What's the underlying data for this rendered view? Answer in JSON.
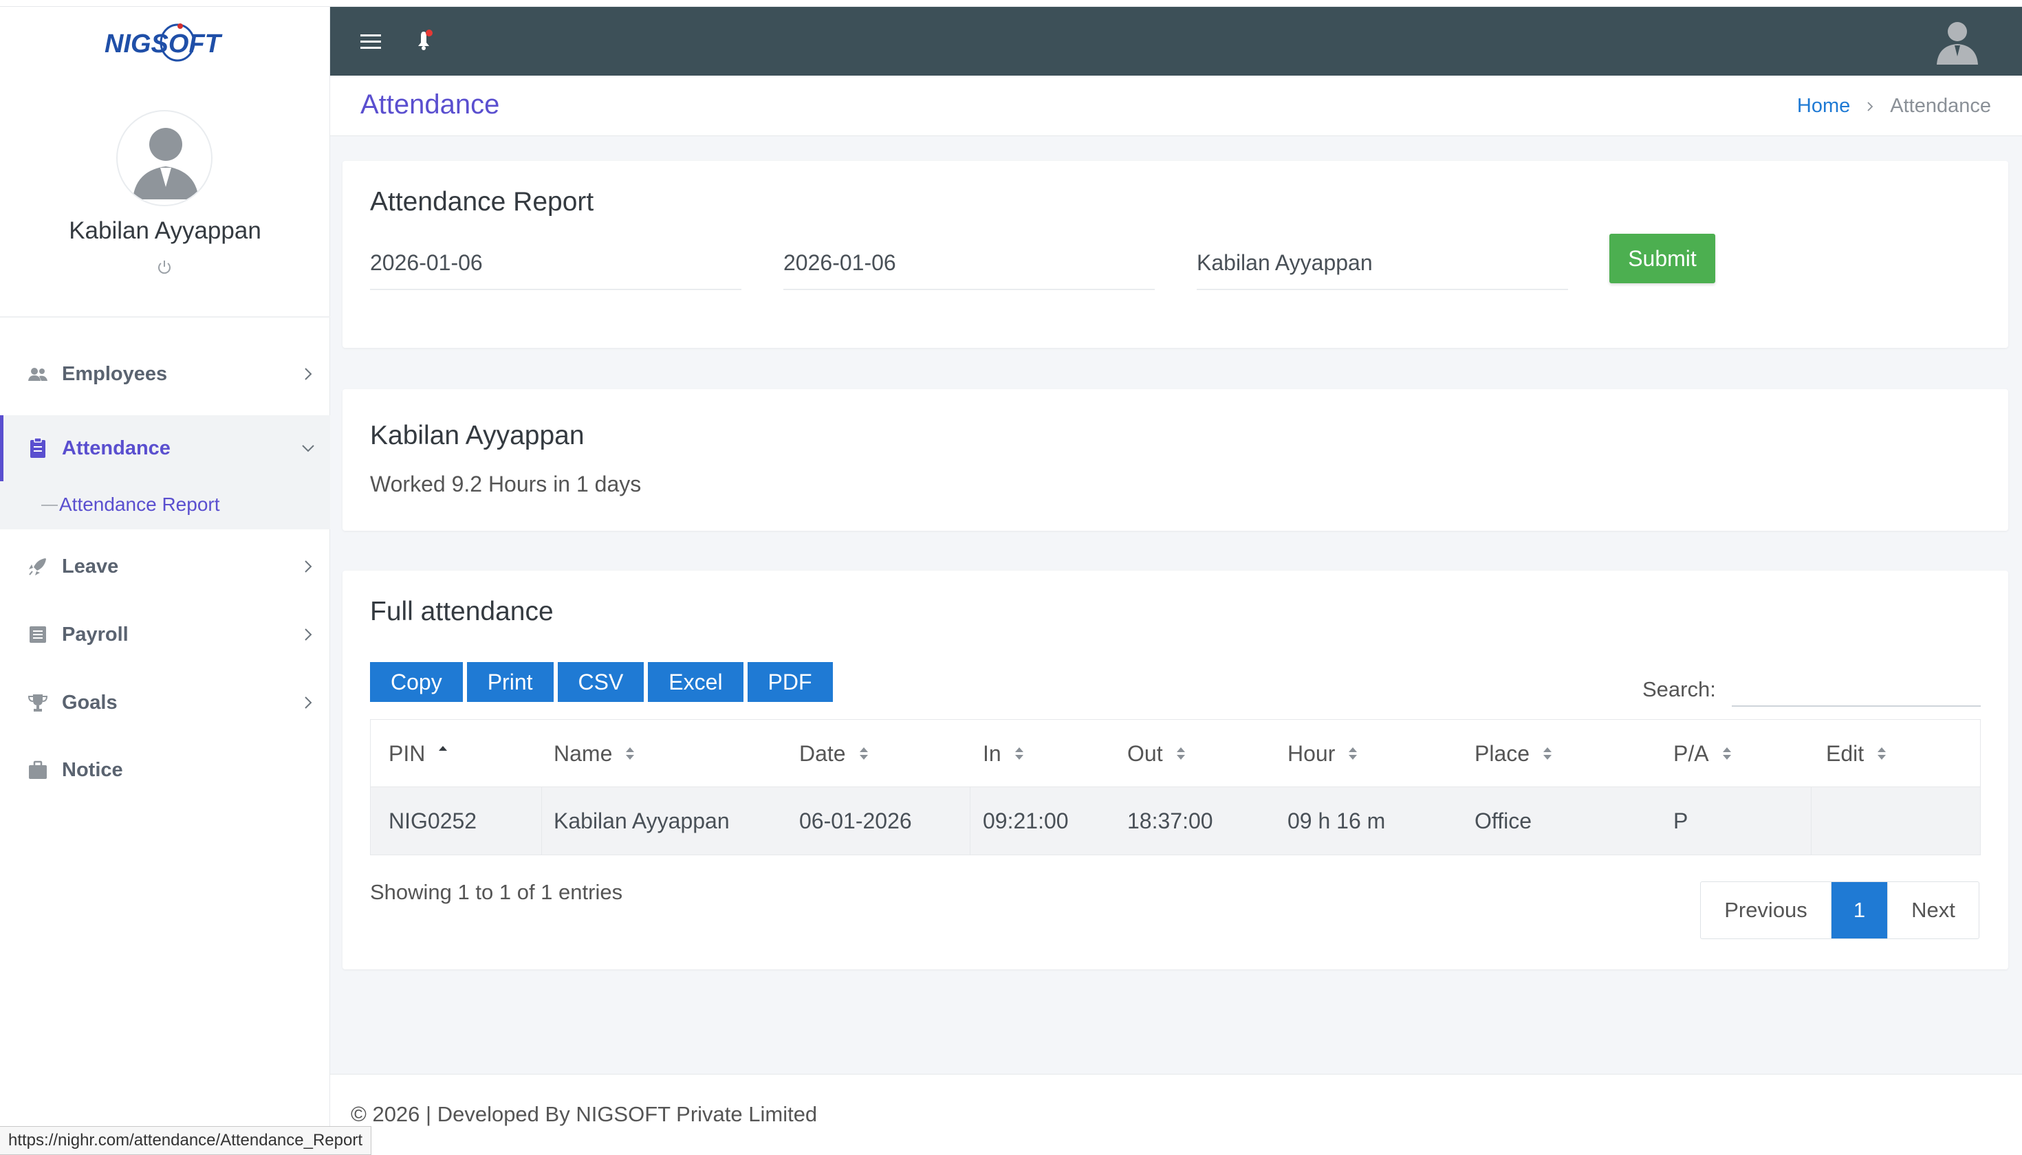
{
  "brand": {
    "logo_text": "NIGSOFT",
    "accent": "#5a4fcf",
    "primary": "#1f7ad4",
    "success": "#4caf50",
    "topbar": "#3d5058"
  },
  "sidebar": {
    "user_name": "Kabilan Ayyappan",
    "items": [
      {
        "label": "Employees",
        "icon": "users-icon"
      },
      {
        "label": "Attendance",
        "icon": "clipboard-icon",
        "active": true,
        "submenu": [
          "Attendance Report"
        ]
      },
      {
        "label": "Leave",
        "icon": "rocket-icon"
      },
      {
        "label": "Payroll",
        "icon": "list-icon"
      },
      {
        "label": "Goals",
        "icon": "trophy-icon"
      },
      {
        "label": "Notice",
        "icon": "briefcase-icon"
      }
    ]
  },
  "header": {
    "page_title": "Attendance",
    "breadcrumb": {
      "home": "Home",
      "current": "Attendance"
    }
  },
  "report_form": {
    "title": "Attendance Report",
    "from_date": "2026-01-06",
    "to_date": "2026-01-06",
    "employee": "Kabilan Ayyappan",
    "submit_label": "Submit"
  },
  "summary": {
    "name": "Kabilan Ayyappan",
    "worked_text": "Worked 9.2 Hours in 1 days"
  },
  "attendance": {
    "title": "Full attendance",
    "export_buttons": [
      "Copy",
      "Print",
      "CSV",
      "Excel",
      "PDF"
    ],
    "search_label": "Search:",
    "search_value": "",
    "columns": [
      "PIN",
      "Name",
      "Date",
      "In",
      "Out",
      "Hour",
      "Place",
      "P/A",
      "Edit"
    ],
    "rows": [
      [
        "NIG0252",
        "Kabilan Ayyappan",
        "06-01-2026",
        "09:21:00",
        "18:37:00",
        "09 h 16 m",
        "Office",
        "P",
        ""
      ]
    ],
    "showing": "Showing 1 to 1 of 1 entries",
    "pagination": {
      "previous": "Previous",
      "current": "1",
      "next": "Next"
    }
  },
  "footer": {
    "text": "© 2026 | Developed By NIGSOFT Private Limited"
  },
  "status_url": "https://nighr.com/attendance/Attendance_Report"
}
